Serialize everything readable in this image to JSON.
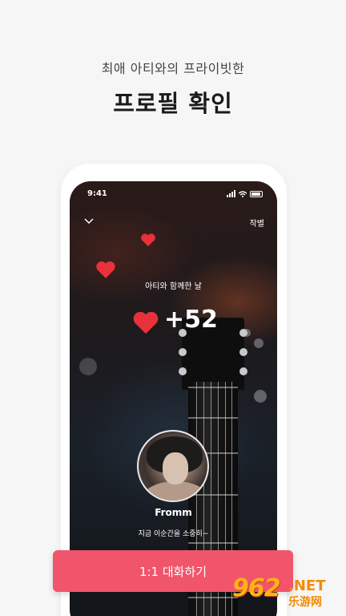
{
  "header": {
    "subtitle": "최애 아티와의 프라이빗한",
    "title": "프로필 확인"
  },
  "phone": {
    "status_time": "9:41",
    "close_label": "작별",
    "together_label": "아티와 함께한 날",
    "day_count": "+52",
    "user": {
      "name": "Fromm",
      "status": "지금 이순간을 소중히~"
    }
  },
  "cta": {
    "label": "1:1 대화하기"
  },
  "watermark": {
    "number": "962",
    "suffix": ".NET",
    "chinese": "乐游网"
  },
  "colors": {
    "accent": "#f1556b",
    "heart": "#e8313b",
    "background": "#f6f6f6"
  }
}
